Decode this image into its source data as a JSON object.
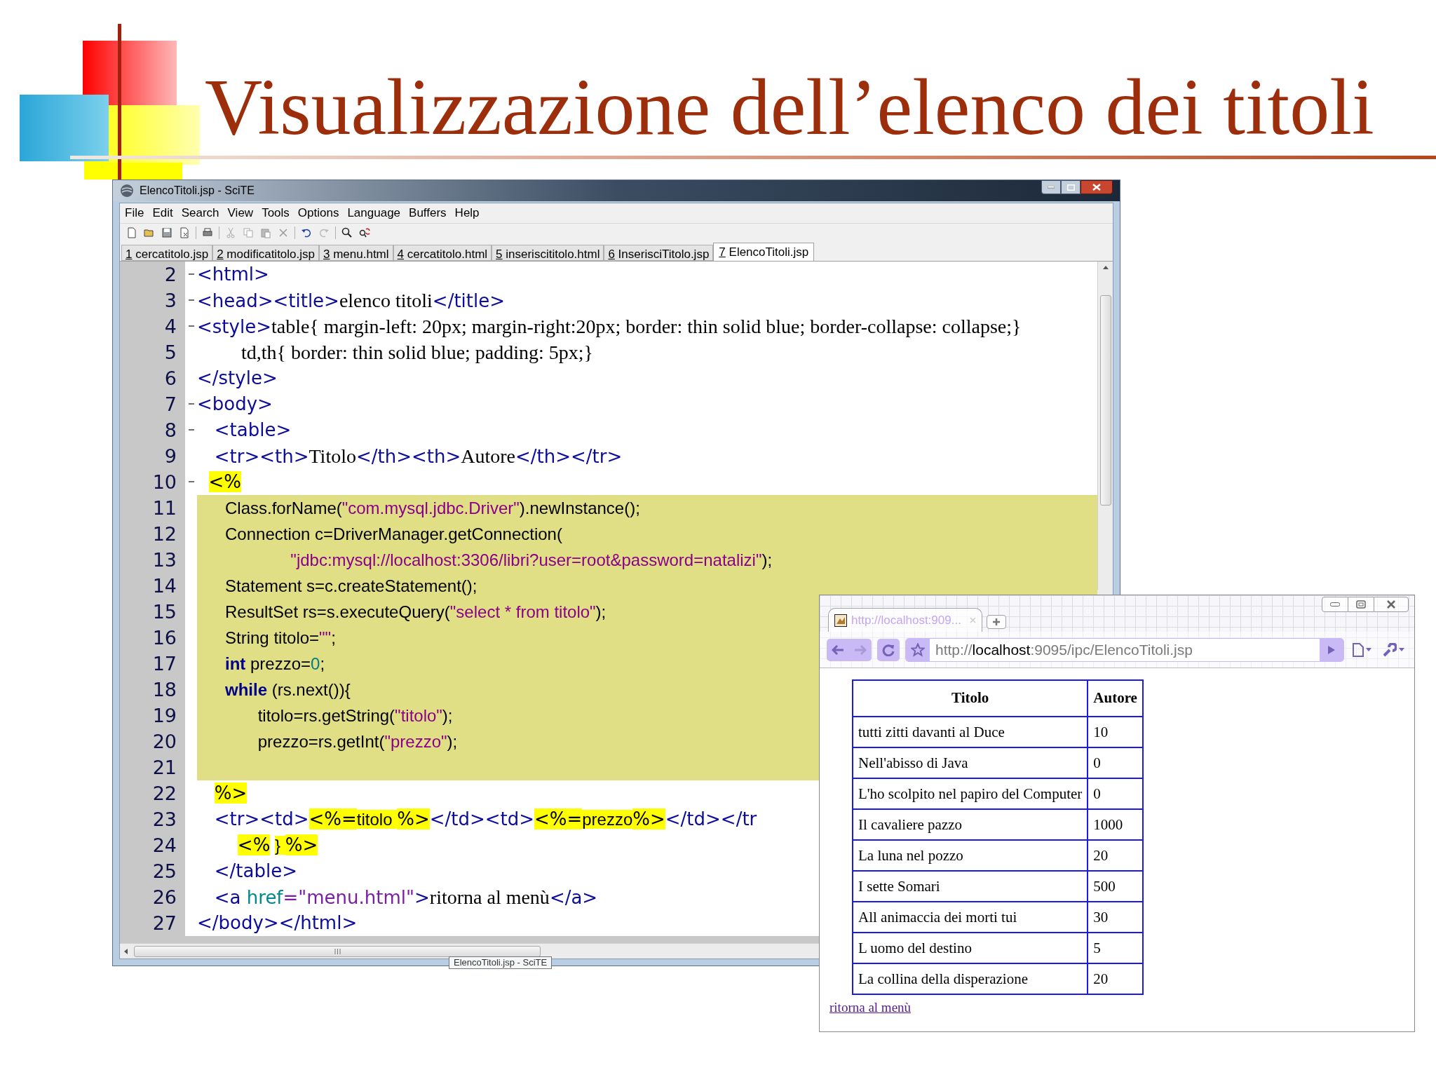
{
  "slide": {
    "title": "Visualizzazione dell’elenco dei titoli"
  },
  "editor": {
    "title": "ElencoTitoli.jsp - SciTE",
    "menu": [
      "File",
      "Edit",
      "Search",
      "View",
      "Tools",
      "Options",
      "Language",
      "Buffers",
      "Help"
    ],
    "tabs": [
      {
        "number": "1",
        "name": "cercatitolo.jsp",
        "selected": false
      },
      {
        "number": "2",
        "name": "modificatitolo.jsp",
        "selected": false
      },
      {
        "number": "3",
        "name": "menu.html",
        "selected": false
      },
      {
        "number": "4",
        "name": "cercatitolo.html",
        "selected": false
      },
      {
        "number": "5",
        "name": "inseriscititolo.html",
        "selected": false
      },
      {
        "number": "6",
        "name": "InserisciTitolo.jsp",
        "selected": false
      },
      {
        "number": "7",
        "name": "ElencoTitoli.jsp",
        "selected": true
      }
    ],
    "lines": [
      {
        "number": "2",
        "fold": true,
        "embedded": false,
        "segments": [
          {
            "kind": "tag",
            "text": "<html>"
          }
        ]
      },
      {
        "number": "3",
        "fold": true,
        "embedded": false,
        "segments": [
          {
            "kind": "tag",
            "text": "<head><title>"
          },
          {
            "kind": "text",
            "text": "elenco titoli"
          },
          {
            "kind": "tag",
            "text": "</title>"
          }
        ]
      },
      {
        "number": "4",
        "fold": true,
        "embedded": false,
        "segments": [
          {
            "kind": "tag",
            "text": "<style>"
          },
          {
            "kind": "text",
            "text": "table{ margin-left: 20px; margin-right:20px; border: thin solid blue; border-collapse: collapse;}"
          }
        ]
      },
      {
        "number": "5",
        "fold": false,
        "embedded": false,
        "segments": [
          {
            "kind": "text",
            "text": "         td,th{ border: thin solid blue; padding: 5px;}"
          }
        ]
      },
      {
        "number": "6",
        "fold": false,
        "embedded": false,
        "segments": [
          {
            "kind": "tag",
            "text": "</style>"
          }
        ]
      },
      {
        "number": "7",
        "fold": true,
        "embedded": false,
        "segments": [
          {
            "kind": "tag",
            "text": "<body>"
          }
        ]
      },
      {
        "number": "8",
        "fold": true,
        "embedded": false,
        "segments": [
          {
            "kind": "tag",
            "text": "   <table>"
          }
        ]
      },
      {
        "number": "9",
        "fold": false,
        "embedded": false,
        "segments": [
          {
            "kind": "tag",
            "text": "   <tr><th>"
          },
          {
            "kind": "text",
            "text": "Titolo"
          },
          {
            "kind": "tag",
            "text": "</th><th>"
          },
          {
            "kind": "text",
            "text": "Autore"
          },
          {
            "kind": "tag",
            "text": "</th></tr>"
          }
        ]
      },
      {
        "number": "10",
        "fold": true,
        "embedded": false,
        "segments": [
          {
            "kind": "jsp",
            "text": "  <%"
          }
        ]
      },
      {
        "number": "11",
        "fold": false,
        "embedded": true,
        "segments": [
          {
            "kind": "code",
            "text": "      Class.forName("
          },
          {
            "kind": "string",
            "text": "\"com.mysql.jdbc.Driver\""
          },
          {
            "kind": "code",
            "text": ").newInstance();"
          }
        ]
      },
      {
        "number": "12",
        "fold": false,
        "embedded": true,
        "segments": [
          {
            "kind": "code",
            "text": "      Connection c=DriverManager.getConnection("
          }
        ]
      },
      {
        "number": "13",
        "fold": false,
        "embedded": true,
        "segments": [
          {
            "kind": "string",
            "text": "                    \"jdbc:mysql://localhost:3306/libri?user=root&password=natalizi\""
          },
          {
            "kind": "code",
            "text": ");"
          }
        ]
      },
      {
        "number": "14",
        "fold": false,
        "embedded": true,
        "segments": [
          {
            "kind": "code",
            "text": "      Statement s=c.createStatement();"
          }
        ]
      },
      {
        "number": "15",
        "fold": false,
        "embedded": true,
        "segments": [
          {
            "kind": "code",
            "text": "      ResultSet rs=s.executeQuery("
          },
          {
            "kind": "string",
            "text": "\"select * from titolo\""
          },
          {
            "kind": "code",
            "text": ");"
          }
        ]
      },
      {
        "number": "16",
        "fold": false,
        "embedded": true,
        "segments": [
          {
            "kind": "code",
            "text": "      String titolo="
          },
          {
            "kind": "string",
            "text": "\"\""
          },
          {
            "kind": "code",
            "text": ";"
          }
        ]
      },
      {
        "number": "17",
        "fold": false,
        "embedded": true,
        "segments": [
          {
            "kind": "keyword",
            "text": "      int"
          },
          {
            "kind": "code",
            "text": " prezzo="
          },
          {
            "kind": "number",
            "text": "0"
          },
          {
            "kind": "code",
            "text": ";"
          }
        ]
      },
      {
        "number": "18",
        "fold": false,
        "embedded": true,
        "segments": [
          {
            "kind": "keyword",
            "text": "      while"
          },
          {
            "kind": "code",
            "text": " (rs.next()){"
          }
        ]
      },
      {
        "number": "19",
        "fold": false,
        "embedded": true,
        "segments": [
          {
            "kind": "code",
            "text": "             titolo=rs.getString("
          },
          {
            "kind": "string",
            "text": "\"titolo\""
          },
          {
            "kind": "code",
            "text": ");"
          }
        ]
      },
      {
        "number": "20",
        "fold": false,
        "embedded": true,
        "segments": [
          {
            "kind": "code",
            "text": "             prezzo=rs.getInt("
          },
          {
            "kind": "string",
            "text": "\"prezzo\""
          },
          {
            "kind": "code",
            "text": ");"
          }
        ]
      },
      {
        "number": "21",
        "fold": false,
        "embedded": true
      },
      {
        "number": "22",
        "fold": false,
        "embedded": false,
        "segments": [
          {
            "kind": "jsp",
            "text": "   %>"
          }
        ]
      },
      {
        "number": "23",
        "fold": false,
        "embedded": false,
        "segments": [
          {
            "kind": "tag",
            "text": "   <tr><td>"
          },
          {
            "kind": "jsp",
            "text": "<%="
          },
          {
            "kind": "jspcode",
            "text": "titolo "
          },
          {
            "kind": "jsp",
            "text": "%>"
          },
          {
            "kind": "tag",
            "text": "</td><td>"
          },
          {
            "kind": "jsp",
            "text": "<%="
          },
          {
            "kind": "jspcode",
            "text": "prezzo"
          },
          {
            "kind": "jsp",
            "text": "%>"
          },
          {
            "kind": "tag",
            "text": "</td></tr"
          }
        ]
      },
      {
        "number": "24",
        "fold": false,
        "embedded": false,
        "segments": [
          {
            "kind": "jsp",
            "text": "       <%"
          },
          {
            "kind": "jspcode",
            "text": " } "
          },
          {
            "kind": "jsp",
            "text": "%>"
          }
        ]
      },
      {
        "number": "25",
        "fold": false,
        "embedded": false,
        "segments": [
          {
            "kind": "tag",
            "text": "   </table>"
          }
        ]
      },
      {
        "number": "26",
        "fold": false,
        "embedded": false,
        "segments": [
          {
            "kind": "tag",
            "text": "   <a "
          },
          {
            "kind": "attr",
            "text": "href"
          },
          {
            "kind": "attrvalue",
            "text": "=\"menu.html\""
          },
          {
            "kind": "tag",
            "text": ">"
          },
          {
            "kind": "text",
            "text": "ritorna al menù"
          },
          {
            "kind": "tag",
            "text": "</a>"
          }
        ]
      },
      {
        "number": "27",
        "fold": false,
        "embedded": false,
        "segments": [
          {
            "kind": "tag",
            "text": "</body></html>"
          }
        ]
      }
    ],
    "taskbar_tooltip": "ElencoTitoli.jsp - SciTE"
  },
  "browser": {
    "tab_title": "http://localhost:909...",
    "url": [
      {
        "kind": "dim",
        "text": "http://"
      },
      {
        "kind": "host",
        "text": "localhost"
      },
      {
        "kind": "dim",
        "text": ":9095/ipc/ElencoTitoli.jsp"
      }
    ],
    "table": {
      "columns": [
        "Titolo",
        "Autore"
      ],
      "rows": [
        [
          "tutti zitti davanti al Duce",
          "10"
        ],
        [
          "Nell'abisso di Java",
          "0"
        ],
        [
          "L'ho scolpito nel papiro del Computer",
          "0"
        ],
        [
          "Il cavaliere pazzo",
          "1000"
        ],
        [
          "La luna nel pozzo",
          "20"
        ],
        [
          "I sette Somari",
          "500"
        ],
        [
          "All animaccia dei morti tui",
          "30"
        ],
        [
          "L uomo del destino",
          "5"
        ],
        [
          "La collina della disperazione",
          "20"
        ]
      ]
    },
    "link": "ritorna al menù"
  }
}
